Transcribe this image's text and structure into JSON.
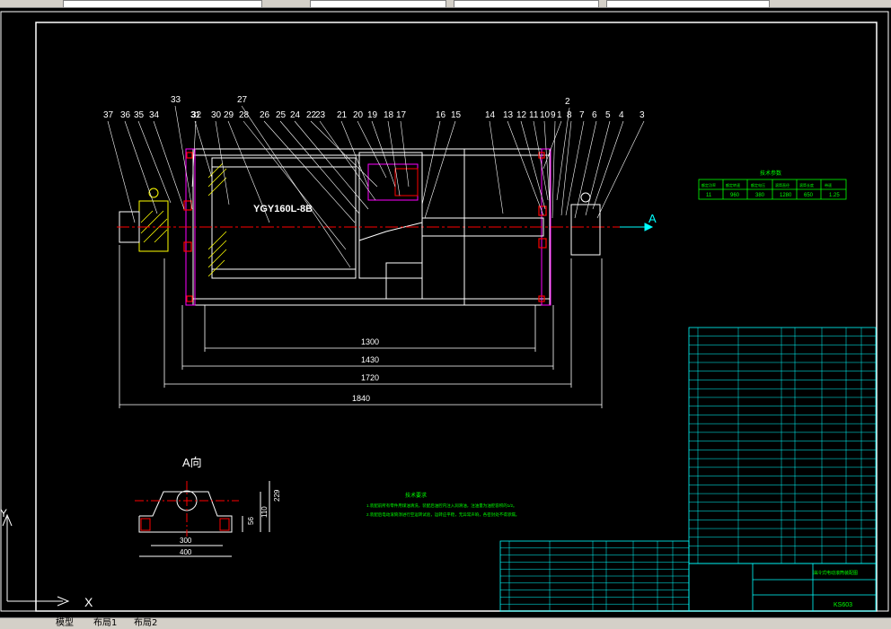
{
  "drawing": {
    "motor_label": "YGY160L-8B",
    "view_marker": "A",
    "section_title": "A向",
    "axis_x_label": "X",
    "axis_y_label": "Y",
    "balloons": [
      "37",
      "36",
      "35",
      "34",
      "33",
      "32",
      "31",
      "30",
      "29",
      "28",
      "27",
      "26",
      "25",
      "24",
      "22",
      "23",
      "21",
      "20",
      "19",
      "18",
      "17",
      "16",
      "15",
      "14",
      "13",
      "12",
      "11",
      "10",
      "9",
      "8",
      "7",
      "6",
      "5",
      "4",
      "3",
      "2",
      "1"
    ],
    "dimensions": {
      "d1300": "1300",
      "d1430": "1430",
      "d1720": "1720",
      "d1840": "1840",
      "d300": "300",
      "d400": "400",
      "d229": "229",
      "d110": "110",
      "d56": "56"
    },
    "params_table": {
      "title": "技术参数",
      "row1": [
        "额定功率",
        "额定转速",
        "额定电压",
        "滚筒直径",
        "滚筒长度",
        "带速"
      ],
      "row2": [
        "11",
        "960",
        "380",
        "1280",
        "650",
        "1.25"
      ]
    },
    "tech_req_title": "技术要求",
    "tech_req_lines": [
      "1.装配前所有零件用煤油清洗，装配后油腔内注入润滑油，注油量为油腔容积的1/2。",
      "2.装配后电动滚筒须进行空运转试验，运转应平稳，无异常声响，各密封处不得渗漏。"
    ]
  },
  "title_block": {
    "drawing_name": "油冷式电动滚筒装配图",
    "drawing_no": "KS603"
  },
  "tabs": {
    "model": "模型",
    "layout1": "布局1",
    "layout2": "布局2"
  }
}
